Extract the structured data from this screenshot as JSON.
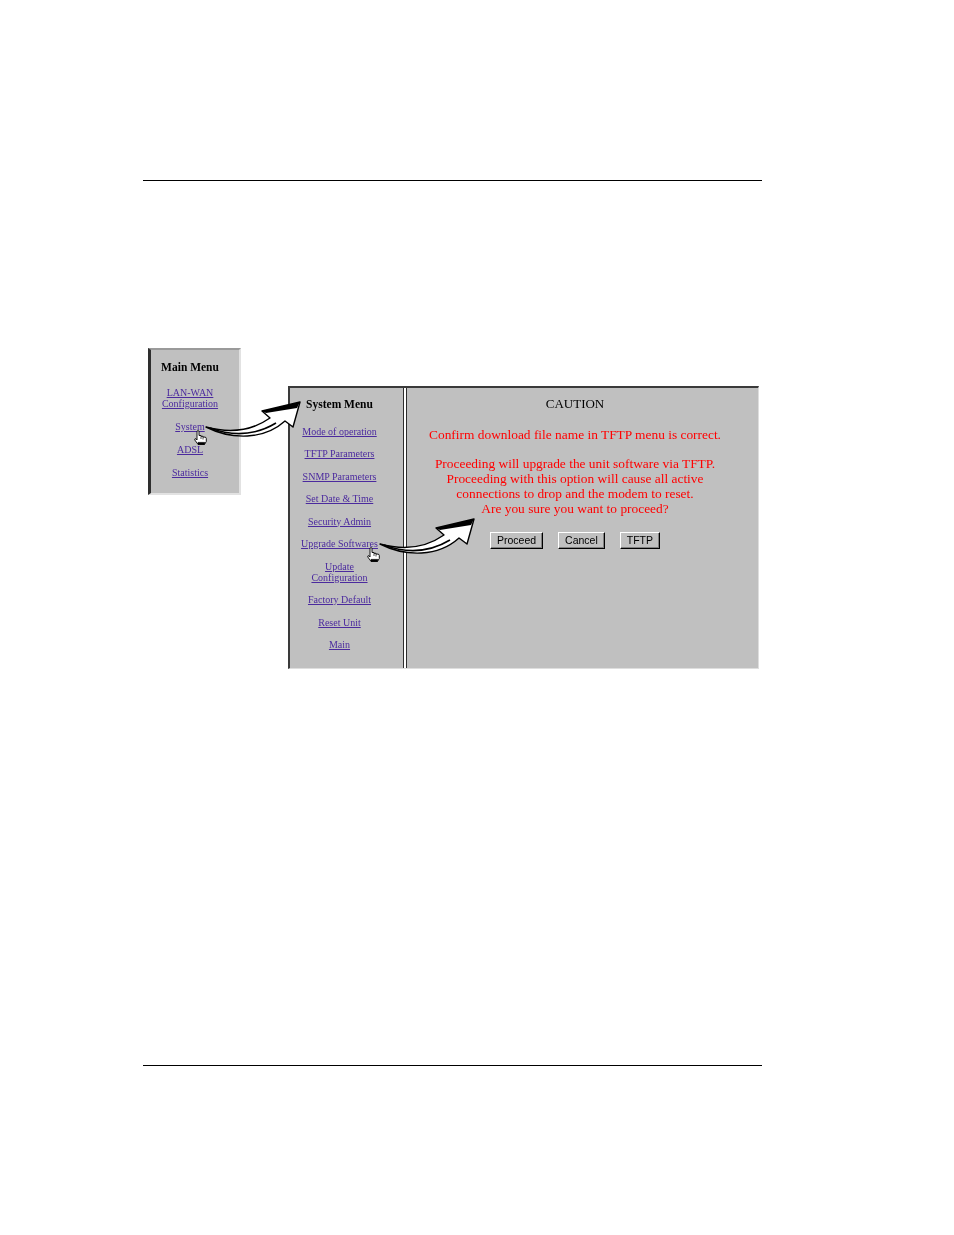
{
  "main_menu": {
    "title": "Main Menu",
    "items": [
      {
        "label": "LAN-WAN Configuration",
        "pointed": false
      },
      {
        "label": "System",
        "pointed": true
      },
      {
        "label": "ADSL",
        "pointed": false
      },
      {
        "label": "Statistics",
        "pointed": false
      }
    ]
  },
  "system_window": {
    "menu": {
      "title": "System Menu",
      "items": [
        {
          "label": "Mode of operation",
          "pointed": false
        },
        {
          "label": "TFTP Parameters",
          "pointed": false
        },
        {
          "label": "SNMP Parameters",
          "pointed": false
        },
        {
          "label": "Set Date & Time",
          "pointed": false
        },
        {
          "label": "Security Admin",
          "pointed": false
        },
        {
          "label": "Upgrade Softwares",
          "pointed": true
        },
        {
          "label": "Update Configuration",
          "pointed": false
        },
        {
          "label": "Factory Default",
          "pointed": false
        },
        {
          "label": "Reset Unit",
          "pointed": false
        },
        {
          "label": "Main",
          "pointed": false
        }
      ]
    },
    "caution": {
      "title": "CAUTION",
      "confirm": "Confirm download file name in TFTP menu is correct.",
      "warning_lines": [
        "Proceeding will upgrade the unit software via TFTP.",
        "Proceeding with this option will cause all active connections to drop and the modem to reset.",
        "Are you sure you want to proceed?"
      ],
      "buttons": [
        "Proceed",
        "Cancel",
        "TFTP"
      ]
    }
  }
}
